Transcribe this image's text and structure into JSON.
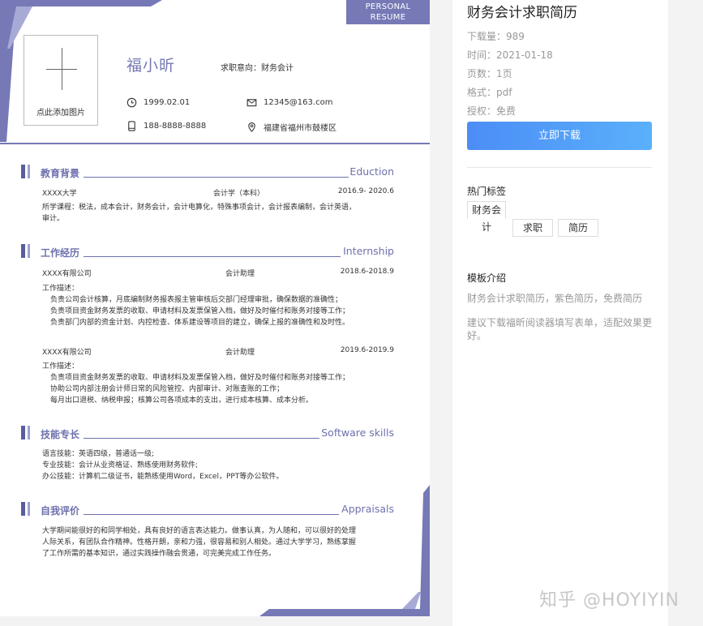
{
  "resume": {
    "badge": {
      "line1": "PERSONAL",
      "line2": "RESUME"
    },
    "photo_caption": "点此添加图片",
    "name": "福小昕",
    "intent": "求职意向：财务会计",
    "birth": "1999.02.01",
    "email": "12345@163.com",
    "phone": "188-8888-8888",
    "address": "福建省福州市鼓楼区",
    "accent": "#7679b6",
    "education": {
      "title": "教育背景",
      "en": "Eduction",
      "school": "XXXX大学",
      "major": "会计学（本科）",
      "period": "2016.9- 2020.6",
      "courses_1": "所学课程：税法，成本会计，财务会计，会计电算化，特殊事项会计，会计报表编制，会计英语，",
      "courses_2": "审计。"
    },
    "work": {
      "title": "工作经历",
      "en": "Internship",
      "jobs": [
        {
          "company": "XXXX有限公司",
          "role": "会计助理",
          "period": "2018.6-2018.9",
          "desc_label": "工作描述：",
          "lines": [
            "负责公司会计核算，月底编制财务报表报主管审核后交部门经理审批，确保数据的准确性；",
            "负责项目资金财务发票的收取、申请材料及发票保管入档，做好及时催付和账务对接等工作；",
            "负责部门内部的资金计划、内控检查、体系建设等项目的建立，确保上报的准确性和及时性。"
          ]
        },
        {
          "company": "XXXX有限公司",
          "role": "会计助理",
          "period": "2019.6-2019.9",
          "desc_label": "工作描述：",
          "lines": [
            "负责项目资金财务发票的收取、申请材料及发票保管入档，做好及时催付和账务对接等工作；",
            "协助公司内部注册会计师日常的风险管控、内部审计、对账查账的工作；",
            "每月出口退税、纳税申报；核算公司各项成本的支出，进行成本核算、成本分析。"
          ]
        }
      ]
    },
    "skills": {
      "title": "技能专长",
      "en": "Software skills",
      "lines": [
        "语言技能：英语四级，普通话一级;",
        "专业技能：会计从业资格证、熟练使用财务软件;",
        "办公技能：计算机二级证书，能熟练使用Word，Excel，PPT等办公软件。"
      ]
    },
    "appraisal": {
      "title": "自我评价",
      "en": "Appraisals",
      "lines": [
        "大学期间能很好的和同学相处，具有良好的语言表达能力。做事认真，为人随和，可以很好的处理",
        "人际关系，有团队合作精神。性格开朗，亲和力强，很容易和别人相处。通过大学学习，熟练掌握",
        "了工作所需的基本知识，通过实践操作融会贯通，可完美完成工作任务。"
      ]
    }
  },
  "sidebar": {
    "title": "财务会计求职简历",
    "downloads": "下载量：989",
    "date": "时间：2021-01-18",
    "pages": "页数：1页",
    "format": "格式：pdf",
    "license": "授权：免费",
    "download_button": "立即下载",
    "tags_title": "热门标签",
    "tags": [
      "财务会计",
      "求职",
      "简历"
    ],
    "template_title": "模板介绍",
    "template_desc": "财务会计求职简历，紫色简历，免费简历",
    "template_note": "建议下载福昕阅读器填写表单，适配效果更好。"
  },
  "watermark": "知乎 @HOYIYIN"
}
